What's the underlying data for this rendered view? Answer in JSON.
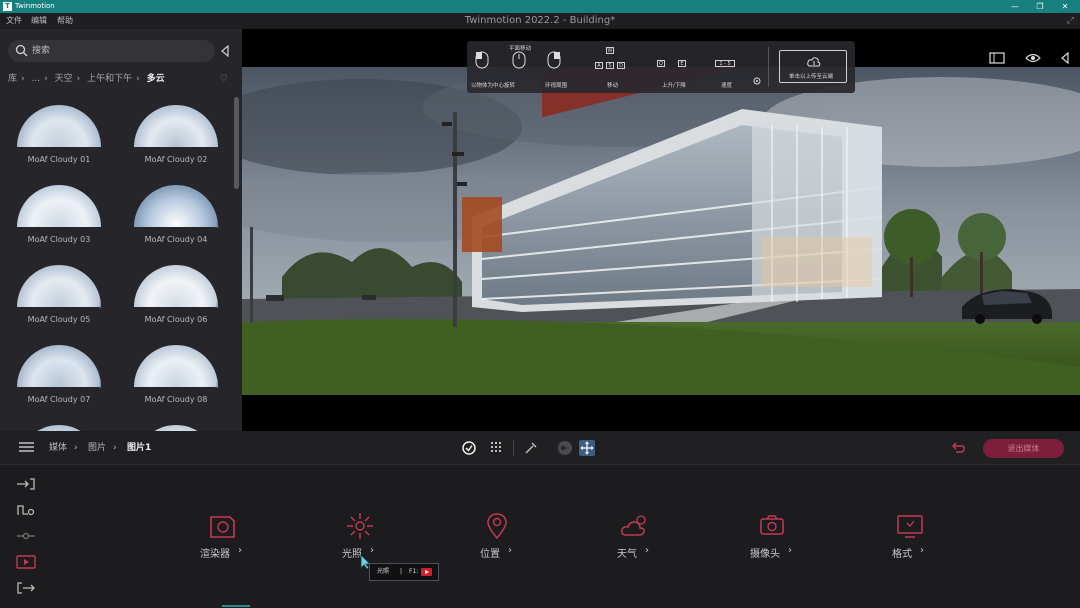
{
  "os_window": {
    "title": "Twinmotion",
    "logo": "T",
    "min": "—",
    "max": "❐",
    "close": "✕"
  },
  "menu": {
    "items": [
      "文件",
      "编辑",
      "帮助"
    ],
    "document_title": "Twinmotion 2022.2 - Building*",
    "expand": "⤢"
  },
  "library": {
    "search_placeholder": "搜索",
    "breadcrumb": [
      "库",
      "...",
      "天空",
      "上午和下午",
      "多云"
    ],
    "items": [
      {
        "label": "MoAf Cloudy 01",
        "download": false
      },
      {
        "label": "MoAf Cloudy 02",
        "download": false
      },
      {
        "label": "MoAf Cloudy 03",
        "download": false
      },
      {
        "label": "MoAf Cloudy 04",
        "download": true
      },
      {
        "label": "MoAf Cloudy 05",
        "download": true
      },
      {
        "label": "MoAf Cloudy 06",
        "download": true
      },
      {
        "label": "MoAf Cloudy 07",
        "download": true
      },
      {
        "label": "MoAf Cloudy 08",
        "download": true
      },
      {
        "label": "",
        "download": true
      },
      {
        "label": "",
        "download": true
      }
    ]
  },
  "navigation_hud": {
    "rotate": "以物体为中心旋转",
    "pan": "平面移动",
    "look_around": "环视周围",
    "move": "移动",
    "up_down": "上升/下降",
    "speed": "速度",
    "speed_value": "1 - 5",
    "keys_move": [
      "W",
      "A",
      "S",
      "D"
    ],
    "keys_updown": [
      "Q",
      "E"
    ],
    "cloud_button": "单击以上传至云端"
  },
  "bottom": {
    "breadcrumb": [
      "媒体",
      "图片",
      "图片1"
    ],
    "main_button": "退出媒体",
    "categories": [
      {
        "label": "渲染器",
        "icon": "renderer-icon"
      },
      {
        "label": "光照",
        "icon": "lighting-icon"
      },
      {
        "label": "位置",
        "icon": "location-icon"
      },
      {
        "label": "天气",
        "icon": "weather-icon"
      },
      {
        "label": "摄像头",
        "icon": "camera-icon"
      },
      {
        "label": "格式",
        "icon": "format-icon"
      }
    ],
    "chevron": "›",
    "tooltip": {
      "label": "光照",
      "sep": "|",
      "shortcut": "F1:"
    }
  },
  "colors": {
    "accent": "#c23a55",
    "os_bar": "#17807f",
    "button": "#7d1f3c",
    "tool_active": "#3d5d84"
  }
}
